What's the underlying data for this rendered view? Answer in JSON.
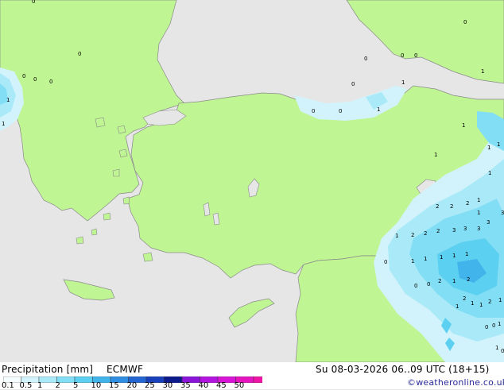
{
  "map": {
    "colors": {
      "sea": "#e6e6e6",
      "land": "#bff593",
      "coast": "#8a8a8a"
    },
    "point_labels": [
      "0",
      "0",
      "0",
      "0",
      "0",
      "0",
      "0",
      "0",
      "0",
      "0",
      "0",
      "0",
      "1",
      "1",
      "1",
      "1",
      "1",
      "1",
      "1",
      "1",
      "1",
      "1",
      "1",
      "2",
      "2",
      "2",
      "2",
      "2",
      "2",
      "3",
      "3",
      "3",
      "3",
      "3",
      "1",
      "1",
      "1",
      "0",
      "0",
      "0",
      "1",
      "1",
      "1",
      "2",
      "1",
      "2",
      "1",
      "1",
      "1",
      "2",
      "1",
      "0",
      "0",
      "1",
      "0",
      "1",
      "2",
      "1"
    ]
  },
  "footer": {
    "title": "Precipitation [mm]",
    "model": "ECMWF",
    "datetime": "Su 08-03-2026 06..09 UTC (18+15)",
    "credit": "©weatheronline.co.uk",
    "legend": {
      "ticks": [
        "0.1",
        "0.5",
        "1",
        "2",
        "5",
        "10",
        "15",
        "20",
        "25",
        "30",
        "35",
        "40",
        "45",
        "50"
      ],
      "colors": [
        "#f5fdff",
        "#d2f3fb",
        "#aaeaf8",
        "#82def5",
        "#5cd0f0",
        "#42b4ec",
        "#2f8de2",
        "#2366d2",
        "#1840ba",
        "#0c1a8c",
        "#8a14d8",
        "#b414e0",
        "#d814d6",
        "#e614be",
        "#f014a6"
      ]
    }
  }
}
